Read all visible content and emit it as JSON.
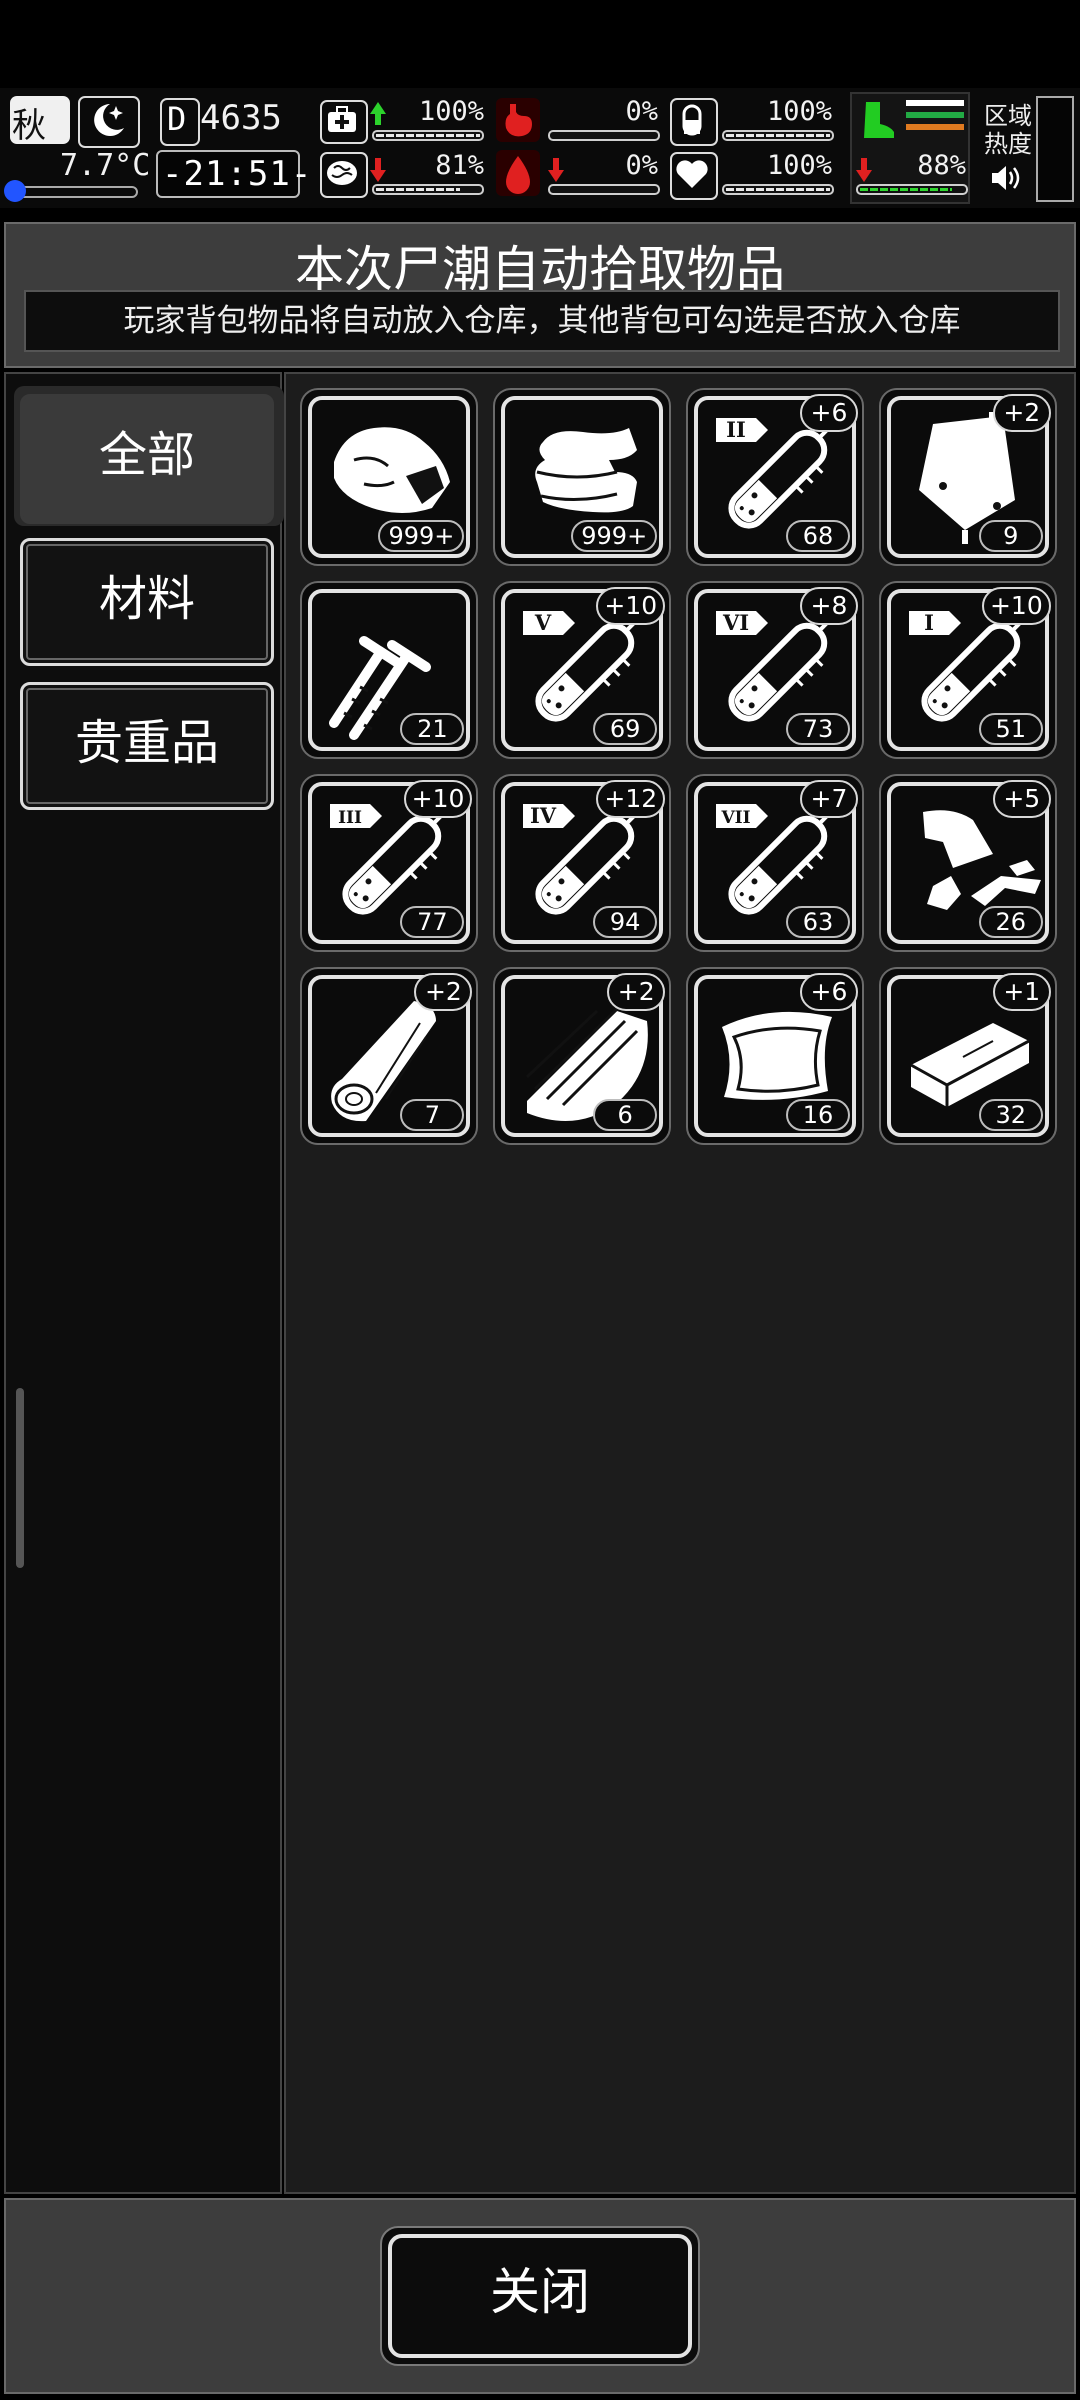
{
  "status": {
    "season": "秋",
    "temperature": "7.7°C",
    "day_counter": "4635",
    "day_prefix": "D",
    "time": "-21:51-",
    "zone_heat_label": "区域热度",
    "stats": [
      {
        "name": "health",
        "value": "100%",
        "trend": "up",
        "level": 1.0
      },
      {
        "name": "hunger",
        "value": "0%",
        "trend": "none",
        "level": 0.0
      },
      {
        "name": "pill",
        "value": "100%",
        "trend": "none",
        "level": 1.0
      },
      {
        "name": "stamina",
        "value": "88%",
        "trend": "down",
        "level": 0.88
      },
      {
        "name": "sanity",
        "value": "81%",
        "trend": "down",
        "level": 0.81
      },
      {
        "name": "blood",
        "value": "0%",
        "trend": "down",
        "level": 0.0
      },
      {
        "name": "heart",
        "value": "100%",
        "trend": "none",
        "level": 1.0
      }
    ],
    "colors": {
      "up": "#2cd32c",
      "down": "#e02020",
      "stamina_icon": "#22cc22"
    }
  },
  "panel": {
    "title": "本次尸潮自动拾取物品",
    "subtitle": "玩家背包物品将自动放入仓库，其他背包可勾选是否放入仓库"
  },
  "categories": [
    {
      "label": "全部",
      "active": true
    },
    {
      "label": "材料",
      "active": false
    },
    {
      "label": "贵重品",
      "active": false
    }
  ],
  "items": [
    {
      "icon": "meat-icon",
      "badge": "",
      "count": "999+"
    },
    {
      "icon": "cloth-icon",
      "badge": "",
      "count": "999+"
    },
    {
      "icon": "syringe-icon",
      "roman": "II",
      "badge": "+6",
      "count": "68"
    },
    {
      "icon": "blood-bag-icon",
      "badge": "+2",
      "count": "9"
    },
    {
      "icon": "nails-icon",
      "badge": "",
      "count": "21"
    },
    {
      "icon": "syringe-icon",
      "roman": "V",
      "badge": "+10",
      "count": "69"
    },
    {
      "icon": "syringe-icon",
      "roman": "VI",
      "badge": "+8",
      "count": "73"
    },
    {
      "icon": "syringe-icon",
      "roman": "I",
      "badge": "+10",
      "count": "51"
    },
    {
      "icon": "syringe-icon",
      "roman": "III",
      "badge": "+10",
      "count": "77"
    },
    {
      "icon": "syringe-icon",
      "roman": "IV",
      "badge": "+12",
      "count": "94"
    },
    {
      "icon": "syringe-icon",
      "roman": "VII",
      "badge": "+7",
      "count": "63"
    },
    {
      "icon": "scrap-metal-icon",
      "badge": "+5",
      "count": "26"
    },
    {
      "icon": "wood-log-icon",
      "badge": "+2",
      "count": "7"
    },
    {
      "icon": "wood-planks-icon",
      "badge": "+2",
      "count": "6"
    },
    {
      "icon": "leather-icon",
      "badge": "+6",
      "count": "16"
    },
    {
      "icon": "brick-icon",
      "badge": "+1",
      "count": "32"
    }
  ],
  "footer": {
    "close_label": "关闭"
  }
}
